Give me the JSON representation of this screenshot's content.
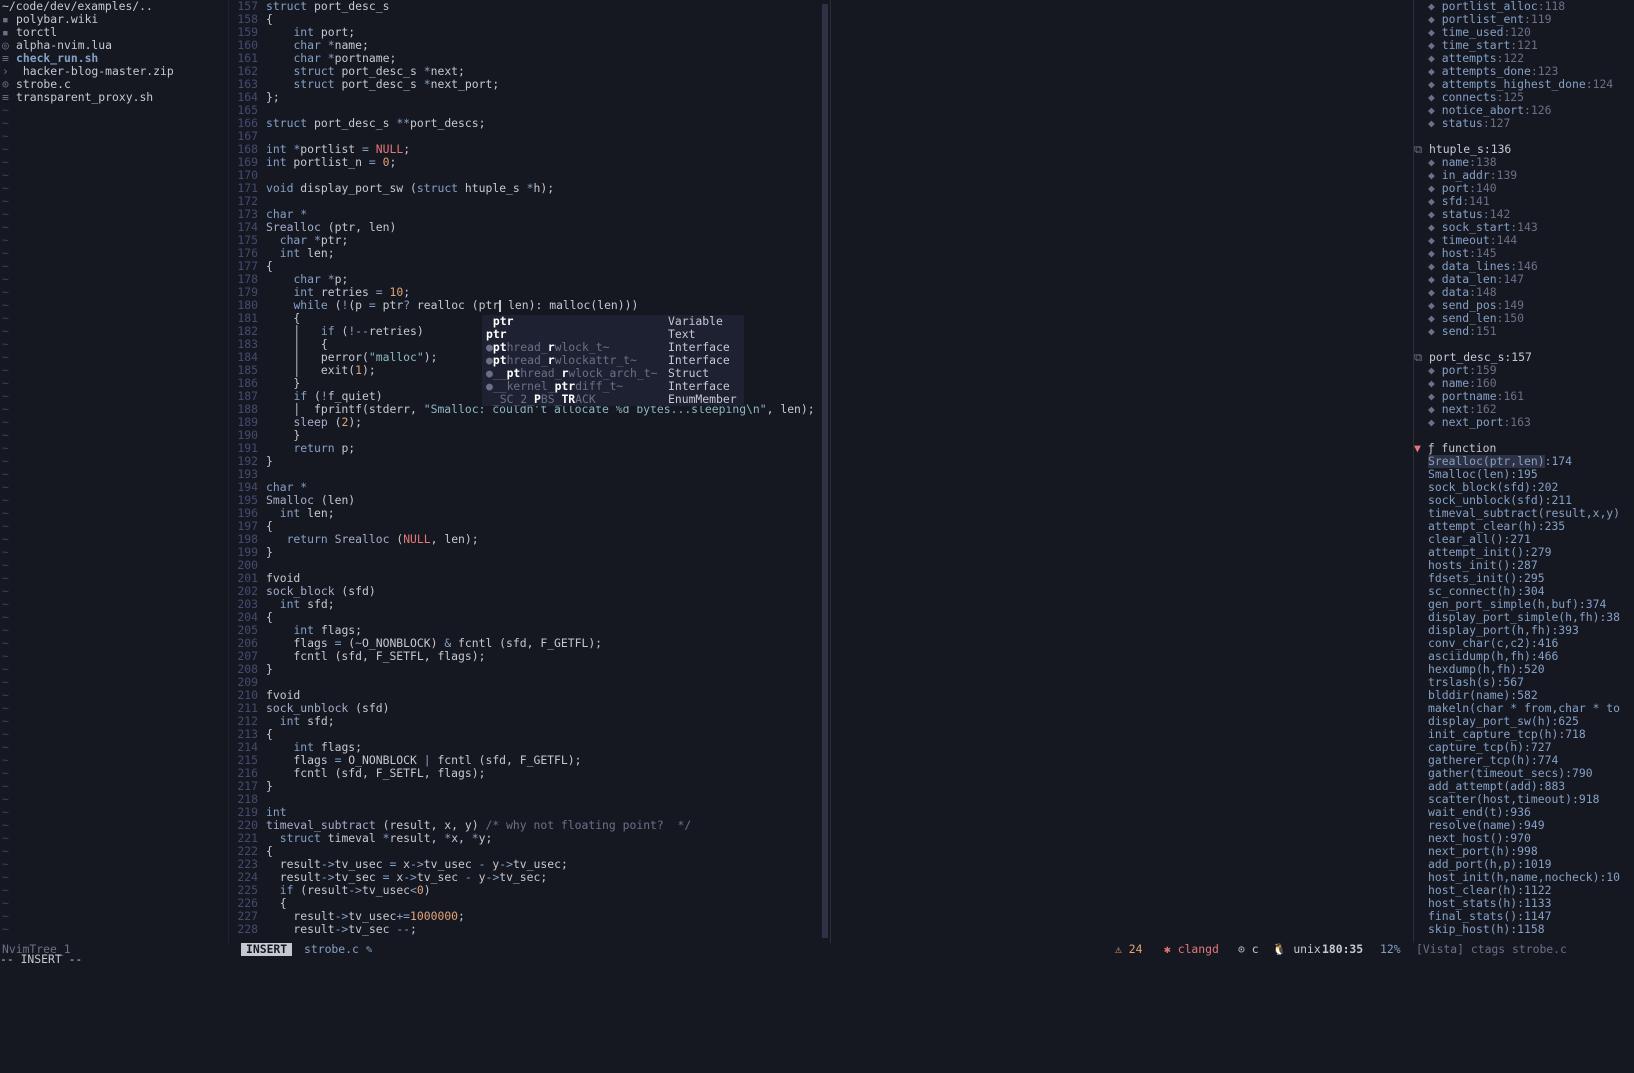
{
  "tree": {
    "root": "~/code/dev/examples/..",
    "items": [
      {
        "icon": "wiki-file-icon",
        "glyph": "▪",
        "name": "polybar.wiki",
        "cls": "dir-path"
      },
      {
        "icon": "file-icon",
        "glyph": "▪",
        "name": "torctl",
        "cls": "dir-path"
      },
      {
        "icon": "lua-file-icon",
        "glyph": "◎",
        "name": "alpha-nvim.lua",
        "cls": "dir-path"
      },
      {
        "icon": "shell-file-icon",
        "glyph": "≡",
        "name": "check_run.sh",
        "cls": "exe"
      },
      {
        "icon": "chevron-right-icon",
        "glyph": "›",
        "name": " hacker-blog-master.zip",
        "cls": "dir-path"
      },
      {
        "icon": "c-file-icon",
        "glyph": "⊙",
        "name": "strobe.c",
        "cls": "dir-path"
      },
      {
        "icon": "shell-file-icon",
        "glyph": "≡",
        "name": "transparent_proxy.sh",
        "cls": "dir-path"
      }
    ],
    "tilde": "~"
  },
  "editor": {
    "lines": [
      [
        "157",
        "<span class=\"kw\">struct</span> port_desc_s"
      ],
      [
        "158",
        "{"
      ],
      [
        "159",
        "    <span class=\"ty\">int</span> port;"
      ],
      [
        "160",
        "    <span class=\"ty\">char</span> <span class=\"op\">*</span>name;"
      ],
      [
        "161",
        "    <span class=\"ty\">char</span> <span class=\"op\">*</span>portname;"
      ],
      [
        "162",
        "    <span class=\"kw\">struct</span> port_desc_s <span class=\"op\">*</span>next;"
      ],
      [
        "163",
        "    <span class=\"kw\">struct</span> port_desc_s <span class=\"op\">*</span>next_port;"
      ],
      [
        "164",
        "};"
      ],
      [
        "165",
        ""
      ],
      [
        "166",
        "<span class=\"kw\">struct</span> port_desc_s <span class=\"op\">**</span>port_descs;"
      ],
      [
        "167",
        ""
      ],
      [
        "168",
        "<span class=\"ty\">int</span> <span class=\"op\">*</span>portlist <span class=\"op\">=</span> <span class=\"nl\">NULL</span>;"
      ],
      [
        "169",
        "<span class=\"ty\">int</span> portlist_n <span class=\"op\">=</span> <span class=\"num\">0</span>;"
      ],
      [
        "170",
        ""
      ],
      [
        "171",
        "<span class=\"ty\">void</span> display_port_sw (<span class=\"kw\">struct</span> htuple_s <span class=\"op\">*</span>h);"
      ],
      [
        "172",
        ""
      ],
      [
        "173",
        "<span class=\"ty\">char</span> <span class=\"op\">*</span>"
      ],
      [
        "174",
        "<span class=\"fn\">Srealloc</span> (ptr, len)"
      ],
      [
        "175",
        "  <span class=\"ty\">char</span> <span class=\"op\">*</span>ptr;"
      ],
      [
        "176",
        "  <span class=\"ty\">int</span> len;"
      ],
      [
        "177",
        "{"
      ],
      [
        "178",
        "    <span class=\"ty\">char</span> <span class=\"op\">*</span>p;"
      ],
      [
        "179",
        "    <span class=\"ty\">int</span> retries <span class=\"op\">=</span> <span class=\"num\">10</span>;"
      ],
      [
        "180",
        "    <span class=\"kw\">while</span> (<span class=\"op\">!</span>(p <span class=\"op\">=</span> ptr<span class=\"op\">?</span> realloc (ptr<span class=\"cursor\"></span> len): malloc(len)))"
      ],
      [
        "181",
        "    {"
      ],
      [
        "182",
        "    │   <span class=\"kw\">if</span> (<span class=\"op\">!--</span>retries)"
      ],
      [
        "183",
        "    │   {"
      ],
      [
        "184",
        "    │   perror(<span class=\"str\">\"malloc\"</span>);"
      ],
      [
        "185",
        "    │   exit(<span class=\"num\">1</span>);"
      ],
      [
        "186",
        "    }"
      ],
      [
        "187",
        "    <span class=\"kw\">if</span> (<span class=\"op\">!</span>f_quiet)"
      ],
      [
        "188",
        "    │  fprintf(stderr, <span class=\"str\">\"Smalloc: couldn't allocate %d bytes...sleeping\\n\"</span>, len);"
      ],
      [
        "189",
        "    <span class=\"fn\">sleep</span> (<span class=\"num\">2</span>);"
      ],
      [
        "190",
        "    }"
      ],
      [
        "191",
        "    <span class=\"kw\">return</span> p;"
      ],
      [
        "192",
        "}"
      ],
      [
        "193",
        ""
      ],
      [
        "194",
        "<span class=\"ty\">char</span> <span class=\"op\">*</span>"
      ],
      [
        "195",
        "<span class=\"fn\">Smalloc</span> (len)"
      ],
      [
        "196",
        "  <span class=\"ty\">int</span> len;"
      ],
      [
        "197",
        "{"
      ],
      [
        "198",
        "   <span class=\"kw\">return</span> <span class=\"fn\">Srealloc</span> (<span class=\"nl\">NULL</span>, len);"
      ],
      [
        "199",
        "}"
      ],
      [
        "200",
        ""
      ],
      [
        "201",
        "fvoid"
      ],
      [
        "202",
        "<span class=\"fn\">sock_block</span> (sfd)"
      ],
      [
        "203",
        "  <span class=\"ty\">int</span> sfd;"
      ],
      [
        "204",
        "{"
      ],
      [
        "205",
        "    <span class=\"ty\">int</span> flags;"
      ],
      [
        "206",
        "    flags <span class=\"op\">=</span> (<span class=\"op\">~</span>O_NONBLOCK) <span class=\"op\">&amp;</span> fcntl (sfd, F_GETFL);"
      ],
      [
        "207",
        "    fcntl (sfd, F_SETFL, flags);"
      ],
      [
        "208",
        "}"
      ],
      [
        "209",
        ""
      ],
      [
        "210",
        "fvoid"
      ],
      [
        "211",
        "<span class=\"fn\">sock_unblock</span> (sfd)"
      ],
      [
        "212",
        "  <span class=\"ty\">int</span> sfd;"
      ],
      [
        "213",
        "{"
      ],
      [
        "214",
        "    <span class=\"ty\">int</span> flags;"
      ],
      [
        "215",
        "    flags <span class=\"op\">=</span> O_NONBLOCK <span class=\"op\">|</span> fcntl (sfd, F_GETFL);"
      ],
      [
        "216",
        "    fcntl (sfd, F_SETFL, flags);"
      ],
      [
        "217",
        "}"
      ],
      [
        "218",
        ""
      ],
      [
        "219",
        "<span class=\"ty\">int</span>"
      ],
      [
        "220",
        "<span class=\"fn\">timeval_subtract</span> (result, x, y) <span class=\"cmt\">/* why not floating point?  */</span>"
      ],
      [
        "221",
        "  <span class=\"kw\">struct</span> timeval <span class=\"op\">*</span>result, <span class=\"op\">*</span>x, <span class=\"op\">*</span>y;"
      ],
      [
        "222",
        "{"
      ],
      [
        "223",
        "  result<span class=\"op\">-&gt;</span>tv_usec <span class=\"op\">=</span> x<span class=\"op\">-&gt;</span>tv_usec <span class=\"op\">-</span> y<span class=\"op\">-&gt;</span>tv_usec;"
      ],
      [
        "224",
        "  result<span class=\"op\">-&gt;</span>tv_sec <span class=\"op\">=</span> x<span class=\"op\">-&gt;</span>tv_sec <span class=\"op\">-</span> y<span class=\"op\">-&gt;</span>tv_sec;"
      ],
      [
        "225",
        "  <span class=\"kw\">if</span> (result<span class=\"op\">-&gt;</span>tv_usec<span class=\"op\">&lt;</span><span class=\"num\">0</span>)"
      ],
      [
        "226",
        "  {"
      ],
      [
        "227",
        "    result<span class=\"op\">-&gt;</span>tv_usec<span class=\"op\">+=</span><span class=\"num\">1000000</span>;"
      ],
      [
        "228",
        "    result<span class=\"op\">-&gt;</span>tv_sec <span class=\"op\">--</span>;"
      ]
    ]
  },
  "completion": {
    "items": [
      {
        "label": "<b>ptr</b>",
        "kind": "Variable",
        "selected": false,
        "indent": true
      },
      {
        "label": "<b>ptr</b>",
        "kind": "Text",
        "selected": false,
        "indent": false
      },
      {
        "label": "●<b>pt</b>hread_<b>r</b>wlock_t~",
        "kind": "Interface",
        "selected": false,
        "indent": false
      },
      {
        "label": "●<b>pt</b>hread_<b>r</b>wlockattr_t~",
        "kind": "Interface",
        "selected": false,
        "indent": false
      },
      {
        "label": "●__<b>pt</b>hread_<b>r</b>wlock_arch_t~",
        "kind": "Struct",
        "selected": false,
        "indent": false
      },
      {
        "label": "●__kernel_<b>ptr</b>diff_t~",
        "kind": "Interface",
        "selected": false,
        "indent": false
      },
      {
        "label": " _SC_2_<b>P</b>BS_<b>TR</b>ACK",
        "kind": "EnumMember",
        "selected": false,
        "indent": false
      }
    ]
  },
  "vista": {
    "top_items": [
      [
        "portlist_alloc",
        "118"
      ],
      [
        "portlist_ent",
        "119"
      ],
      [
        "time_used",
        "120"
      ],
      [
        "time_start",
        "121"
      ],
      [
        "attempts",
        "122"
      ],
      [
        "attempts_done",
        "123"
      ],
      [
        "attempts_highest_done",
        "124"
      ],
      [
        "connects",
        "125"
      ],
      [
        "notice_abort",
        "126"
      ],
      [
        "status",
        "127"
      ]
    ],
    "htuple_header": "htuple_s:136",
    "htuple_items": [
      [
        "name",
        "138"
      ],
      [
        "in_addr",
        "139"
      ],
      [
        "port",
        "140"
      ],
      [
        "sfd",
        "141"
      ],
      [
        "status",
        "142"
      ],
      [
        "sock_start",
        "143"
      ],
      [
        "timeout",
        "144"
      ],
      [
        "host",
        "145"
      ],
      [
        "data_lines",
        "146"
      ],
      [
        "data_len",
        "147"
      ],
      [
        "data",
        "148"
      ],
      [
        "send_pos",
        "149"
      ],
      [
        "send_len",
        "150"
      ],
      [
        "send",
        "151"
      ]
    ],
    "portdesc_header": "port_desc_s:157",
    "portdesc_items": [
      [
        "port",
        "159"
      ],
      [
        "name",
        "160"
      ],
      [
        "portname",
        "161"
      ],
      [
        "next",
        "162"
      ],
      [
        "next_port",
        "163"
      ]
    ],
    "function_header": "ƒ function",
    "functions": [
      [
        "Srealloc(ptr,len)",
        "174"
      ],
      [
        "Smalloc(len)",
        "195"
      ],
      [
        "sock_block(sfd)",
        "202"
      ],
      [
        "sock_unblock(sfd)",
        "211"
      ],
      [
        "timeval_subtract(result,x,y)",
        ""
      ],
      [
        "attempt_clear(h)",
        "235"
      ],
      [
        "clear_all()",
        "271"
      ],
      [
        "attempt_init()",
        "279"
      ],
      [
        "hosts_init()",
        "287"
      ],
      [
        "fdsets_init()",
        "295"
      ],
      [
        "sc_connect(h)",
        "304"
      ],
      [
        "gen_port_simple(h,buf)",
        "374"
      ],
      [
        "display_port_simple(h,fh)",
        "38"
      ],
      [
        "display_port(h,fh)",
        "393"
      ],
      [
        "conv_char(c,c2)",
        "416"
      ],
      [
        "asciidump(h,fh)",
        "466"
      ],
      [
        "hexdump(h,fh)",
        "520"
      ],
      [
        "trslash(s)",
        "567"
      ],
      [
        "blddir(name)",
        "582"
      ],
      [
        "makeln(char * from,char * to",
        ""
      ],
      [
        "display_port_sw(h)",
        "625"
      ],
      [
        "init_capture_tcp(h)",
        "718"
      ],
      [
        "capture_tcp(h)",
        "727"
      ],
      [
        "gatherer_tcp(h)",
        "774"
      ],
      [
        "gather(timeout_secs)",
        "790"
      ],
      [
        "add_attempt(add)",
        "883"
      ],
      [
        "scatter(host,timeout)",
        "918"
      ],
      [
        "wait_end(t)",
        "936"
      ],
      [
        "resolve(name)",
        "949"
      ],
      [
        "next_host()",
        "970"
      ],
      [
        "next_port(h)",
        "998"
      ],
      [
        "add_port(h,p)",
        "1019"
      ],
      [
        "host_init(h,name,nocheck)",
        "10"
      ],
      [
        "host_clear(h)",
        "1122"
      ],
      [
        "host_stats(h)",
        "1133"
      ],
      [
        "final_stats()",
        "1147"
      ],
      [
        "skip_host(h)",
        "1158"
      ]
    ]
  },
  "status": {
    "tree_name": "NvimTree_1",
    "mode": "INSERT",
    "file": "strobe.c ✎",
    "warnings": "⚠ 24",
    "lsp": "✱ clangd",
    "filetype": "⊙ c  🐧 unix",
    "position": "180:35",
    "percent": "12%",
    "vista": "[Vista] ctags strobe.c"
  },
  "cmdline": "-- INSERT --"
}
